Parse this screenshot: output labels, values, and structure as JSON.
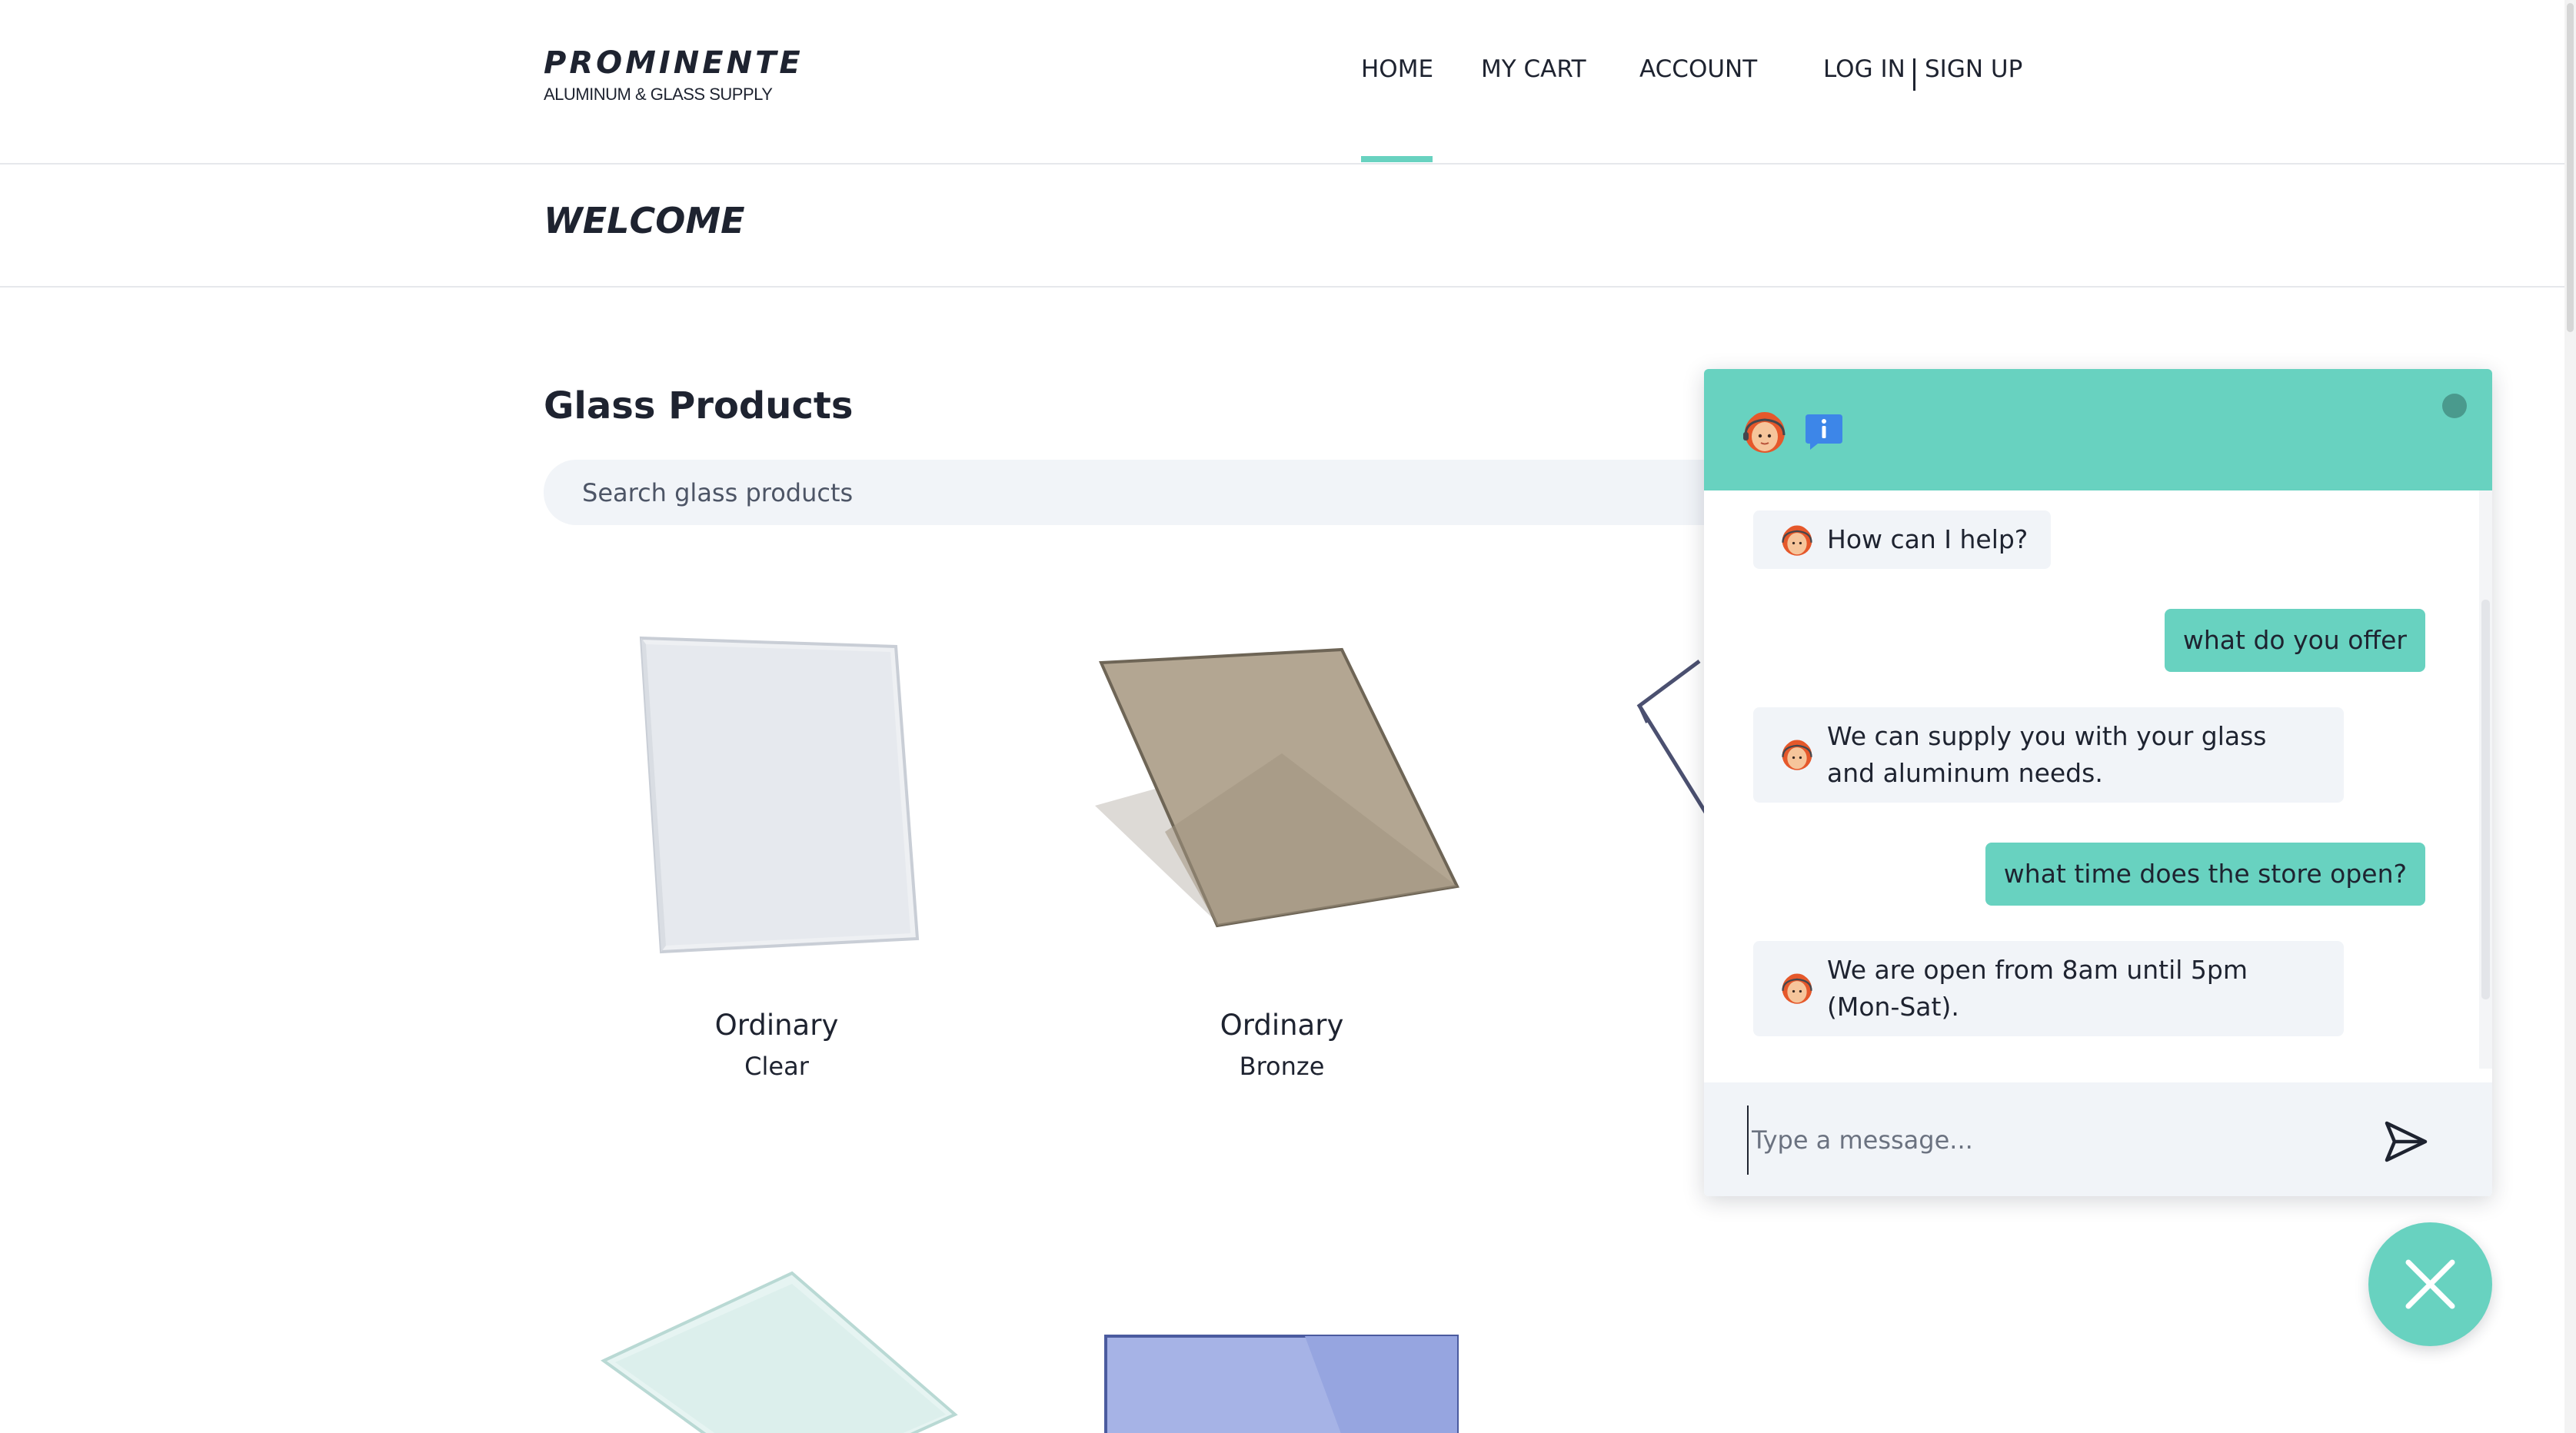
{
  "brand": {
    "title": "PROMINENTE",
    "subtitle": "ALUMINUM & GLASS SUPPLY"
  },
  "nav": {
    "items": [
      {
        "label": "HOME",
        "active": true
      },
      {
        "label": "MY CART"
      },
      {
        "label": "ACCOUNT"
      }
    ],
    "login_label": "LOG IN",
    "signup_label": "SIGN UP"
  },
  "page": {
    "banner_title": "WELCOME",
    "section_title": "Glass Products",
    "search_placeholder": "Search glass products"
  },
  "products": [
    {
      "name": "Ordinary",
      "variant": "Clear",
      "icon": "clear-glass-pane-icon"
    },
    {
      "name": "Ordinary",
      "variant": "Bronze",
      "icon": "bronze-glass-pane-icon"
    },
    {
      "name": "",
      "variant": "",
      "icon": "glass-pane-icon"
    },
    {
      "name": "",
      "variant": "",
      "icon": "blue-glass-pane-icon"
    }
  ],
  "chat": {
    "icons": [
      "support-agent-avatar-icon",
      "info-icon"
    ],
    "messages": [
      {
        "from": "bot",
        "text": "How can I help?"
      },
      {
        "from": "user",
        "text": "what do you offer"
      },
      {
        "from": "bot",
        "text": "We can supply you with your glass and aluminum needs."
      },
      {
        "from": "user",
        "text": "what time does the store open?"
      },
      {
        "from": "bot",
        "text": "We are open from 8am until 5pm (Mon-Sat)."
      }
    ],
    "input_placeholder": "Type a message..."
  },
  "colors": {
    "accent": "#68d2c0",
    "text": "#1e2330",
    "bubble_bg": "#f1f4f8",
    "bronze": "#b3a692",
    "blue_glass": "#a6b3e6"
  }
}
